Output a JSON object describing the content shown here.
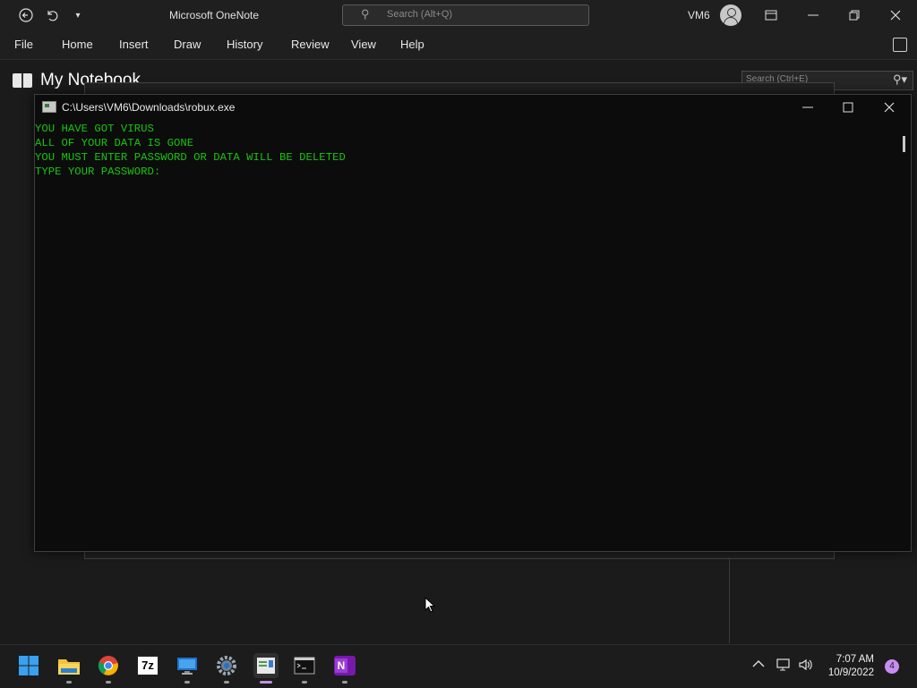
{
  "app": {
    "title": "Microsoft OneNote",
    "search_placeholder": "Search (Alt+Q)",
    "user": "VM6"
  },
  "menu": {
    "items": [
      "File",
      "Home",
      "Insert",
      "Draw",
      "History",
      "Review",
      "View",
      "Help"
    ]
  },
  "notebook": {
    "title": "My Notebook",
    "search_placeholder": "Search (Ctrl+E)"
  },
  "console": {
    "path": "C:\\Users\\VM6\\Downloads\\robux.exe",
    "lines": [
      "YOU HAVE GOT VIRUS",
      "ALL OF YOUR DATA IS GONE",
      "YOU MUST ENTER PASSWORD OR DATA WILL BE DELETED",
      "TYPE YOUR PASSWORD:"
    ],
    "text_color": "#16c60c"
  },
  "taskbar": {
    "apps": [
      "start-icon",
      "file-explorer-icon",
      "chrome-icon",
      "7zip-icon",
      "remote-desktop-icon",
      "settings-icon",
      "notepad-icon",
      "terminal-icon",
      "onenote-icon"
    ],
    "seven_zip_label": "7z",
    "onenote_label": "N",
    "time": "7:07 AM",
    "date": "10/9/2022",
    "notifications": "4"
  }
}
